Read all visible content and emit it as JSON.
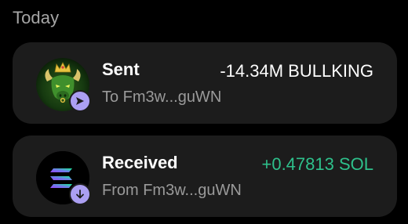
{
  "section": {
    "label": "Today"
  },
  "colors": {
    "background": "#000000",
    "card": "#1c1c1c",
    "badge": "#ab9ff2",
    "positive": "#2ec08b",
    "muted": "#9a9a9a"
  },
  "transactions": [
    {
      "title": "Sent",
      "subtitle": "To Fm3w...guWN",
      "amount": "-14.34M BULLKING",
      "avatar_icon": "bull-king-token-icon",
      "badge_icon": "send-arrow-icon"
    },
    {
      "title": "Received",
      "subtitle": "From Fm3w...guWN",
      "amount": "+0.47813 SOL",
      "avatar_icon": "solana-token-icon",
      "badge_icon": "arrow-down-icon"
    }
  ]
}
